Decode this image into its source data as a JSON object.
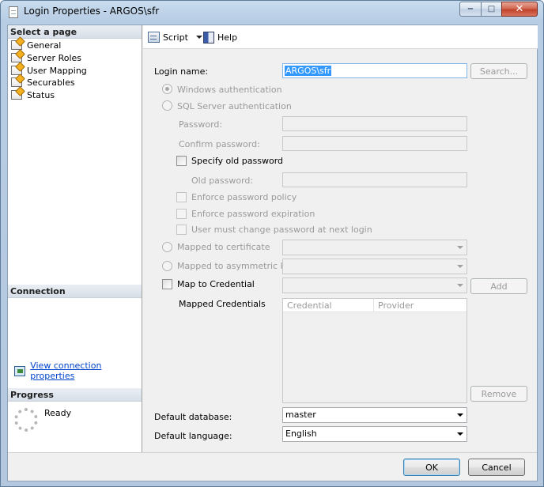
{
  "window": {
    "title": "Login Properties - ARGOS\\sfr",
    "minimize": "−",
    "maximize": "□",
    "close": "✕"
  },
  "left_pane": {
    "select_page_header": "Select a page",
    "pages": [
      "General",
      "Server Roles",
      "User Mapping",
      "Securables",
      "Status"
    ],
    "connection_header": "Connection",
    "connection_link": "View connection properties",
    "progress_header": "Progress",
    "progress_status": "Ready"
  },
  "toolbar": {
    "script_label": "Script",
    "help_label": "Help"
  },
  "form": {
    "login_name_label": "Login name:",
    "login_name_value": "ARGOS\\sfr",
    "search_button": "Search...",
    "windows_auth": "Windows authentication",
    "sql_auth": "SQL Server authentication",
    "password_label": "Password:",
    "confirm_password_label": "Confirm password:",
    "specify_old_password": "Specify old password",
    "old_password_label": "Old password:",
    "enforce_policy": "Enforce password policy",
    "enforce_expiration": "Enforce password expiration",
    "must_change": "User must change password at next login",
    "mapped_certificate": "Mapped to certificate",
    "mapped_asym_key": "Mapped to asymmetric key",
    "map_credential": "Map to Credential",
    "add_button": "Add",
    "mapped_credentials_label": "Mapped Credentials",
    "credentials_columns": [
      "Credential",
      "Provider"
    ],
    "remove_button": "Remove",
    "default_database_label": "Default database:",
    "default_database_value": "master",
    "default_language_label": "Default language:",
    "default_language_value": "English"
  },
  "footer": {
    "ok_button": "OK",
    "cancel_button": "Cancel"
  }
}
